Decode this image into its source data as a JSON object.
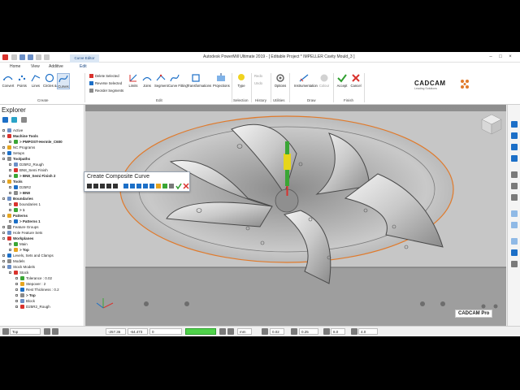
{
  "window": {
    "title": "Autodesk PowerMill Ultimate 2019  -  [ Editable Project * IMPELLER Cavity Mould_3 ]",
    "contextual_tab": "Curve Editor"
  },
  "ribbon_tabs": [
    "Home",
    "View",
    "Additive",
    "Edit"
  ],
  "ribbon": {
    "create": {
      "label": "Create",
      "buttons": [
        "Convert",
        "Points",
        "Lines",
        "Circles & Arcs",
        "Curves"
      ]
    },
    "smallcmds": [
      "Delete Selected",
      "Reverse Selected",
      "Reorder Segments"
    ],
    "edit": {
      "label": "Edit",
      "buttons": [
        "Limits",
        "Joins",
        "Segment",
        "Curve Fitting",
        "Transformations",
        "Projections"
      ]
    },
    "selection": {
      "label": "Selection",
      "buttons": [
        "Type"
      ]
    },
    "history": {
      "label": "History",
      "buttons": [
        "Redo",
        "Undo"
      ]
    },
    "utilities": {
      "label": "Utilities",
      "buttons": [
        "Options"
      ]
    },
    "draw": {
      "label": "Draw",
      "buttons": [
        "Instrumentation",
        "Colour"
      ]
    },
    "finish": {
      "label": "Finish",
      "buttons": [
        "Accept",
        "Cancel"
      ]
    },
    "logo": {
      "text": "CADCAM",
      "subtext": "Leading Solutions"
    }
  },
  "explorer": {
    "title": "Explorer",
    "items": [
      {
        "label": "Active",
        "level": 0,
        "bold": false
      },
      {
        "label": "Machine Tools",
        "level": 0,
        "bold": true
      },
      {
        "label": "> PMPOST-Hermle_C600",
        "level": 1,
        "bold": true
      },
      {
        "label": "NC Programs",
        "level": 0,
        "bold": false
      },
      {
        "label": "Setups",
        "level": 0,
        "bold": false
      },
      {
        "label": "Toolpaths",
        "level": 0,
        "bold": true
      },
      {
        "label": "D25R2_Rough",
        "level": 1,
        "bold": false
      },
      {
        "label": "BN8_Semi Finish",
        "level": 1,
        "bold": false
      },
      {
        "label": "> BN8_Semi Finish 2",
        "level": 1,
        "bold": true
      },
      {
        "label": "Tools",
        "level": 0,
        "bold": true
      },
      {
        "label": "D25R2",
        "level": 1,
        "bold": false
      },
      {
        "label": "> BN8",
        "level": 1,
        "bold": true
      },
      {
        "label": "Boundaries",
        "level": 0,
        "bold": true
      },
      {
        "label": "boundaries 1",
        "level": 1,
        "bold": false
      },
      {
        "label": "> 1",
        "level": 1,
        "bold": true
      },
      {
        "label": "Patterns",
        "level": 0,
        "bold": true
      },
      {
        "label": "> Patterns 1",
        "level": 1,
        "bold": true
      },
      {
        "label": "Feature Groups",
        "level": 0,
        "bold": false
      },
      {
        "label": "Hole Feature Sets",
        "level": 0,
        "bold": false
      },
      {
        "label": "Workplanes",
        "level": 0,
        "bold": true
      },
      {
        "label": "Main",
        "level": 1,
        "bold": false
      },
      {
        "label": "> Top",
        "level": 1,
        "bold": true
      },
      {
        "label": "Levels, Sets and Clamps",
        "level": 0,
        "bold": false
      },
      {
        "label": "Models",
        "level": 0,
        "bold": false
      },
      {
        "label": "Stock Models",
        "level": 0,
        "bold": false
      },
      {
        "label": "Stock",
        "level": 1,
        "bold": false
      },
      {
        "label": "Tolerance : 0.02",
        "level": 2,
        "bold": false
      },
      {
        "label": "Stepover : 2",
        "level": 2,
        "bold": false
      },
      {
        "label": "Rest Thickness : 0.2",
        "level": 2,
        "bold": false
      },
      {
        "label": "> Top",
        "level": 2,
        "bold": true
      },
      {
        "label": "Block",
        "level": 2,
        "bold": false
      },
      {
        "label": "D25R2_Rough",
        "level": 2,
        "bold": false
      }
    ]
  },
  "floating_toolbar": {
    "title": "Create Composite Curve"
  },
  "viewport": {
    "watermark": "CADCAM Pro"
  },
  "statusbar": {
    "workplane": "Top",
    "x": "-257.36",
    "y": "-64.473",
    "z": "0",
    "units": "mm",
    "tolerance": "0.02",
    "thickness": "0.25",
    "tool_dia": "8.0",
    "value": "4.0"
  },
  "colors": {
    "accent": "#1c4a86",
    "tool_yellow": "#e6d51a",
    "tool_green": "#3aa635",
    "outline_orange": "#e07a2b",
    "status_green": "#4fd24a"
  }
}
